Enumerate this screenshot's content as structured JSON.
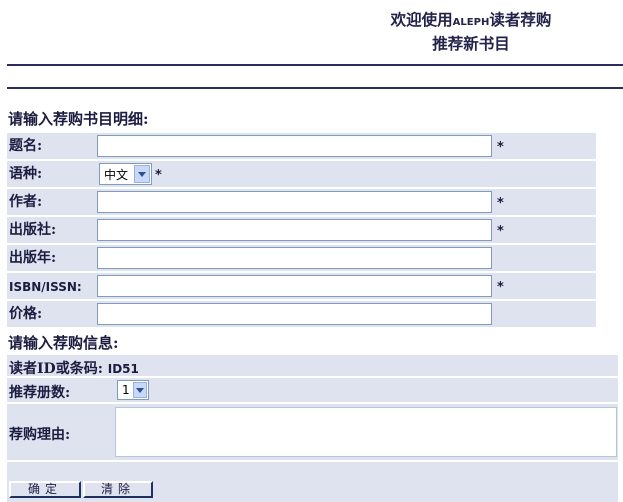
{
  "header": {
    "title_prefix": "欢迎使用",
    "title_brand": "ALEPH",
    "title_suffix": "读者荐购",
    "subtitle": "推荐新书目"
  },
  "book_section": {
    "heading": "请输入荐购书目明细:",
    "fields": [
      {
        "label": "题名:",
        "value": "",
        "required": "*"
      },
      {
        "label": "语种:",
        "value": "中文",
        "required": "*"
      },
      {
        "label": "作者:",
        "value": "",
        "required": "*"
      },
      {
        "label": "出版社:",
        "value": "",
        "required": "*"
      },
      {
        "label": "出版年:",
        "value": ""
      },
      {
        "label": "ISBN/ISSN:",
        "value": "",
        "required": "*"
      },
      {
        "label": "价格:",
        "value": ""
      }
    ]
  },
  "recommend_section": {
    "heading": "请输入荐购信息:",
    "reader_label": "读者ID或条码:",
    "reader_value": "ID51",
    "copies_label": "推荐册数:",
    "copies_value": "1",
    "reason_label": "荐购理由:",
    "reason_value": ""
  },
  "buttons": {
    "confirm": "确定",
    "clear": "清除"
  }
}
